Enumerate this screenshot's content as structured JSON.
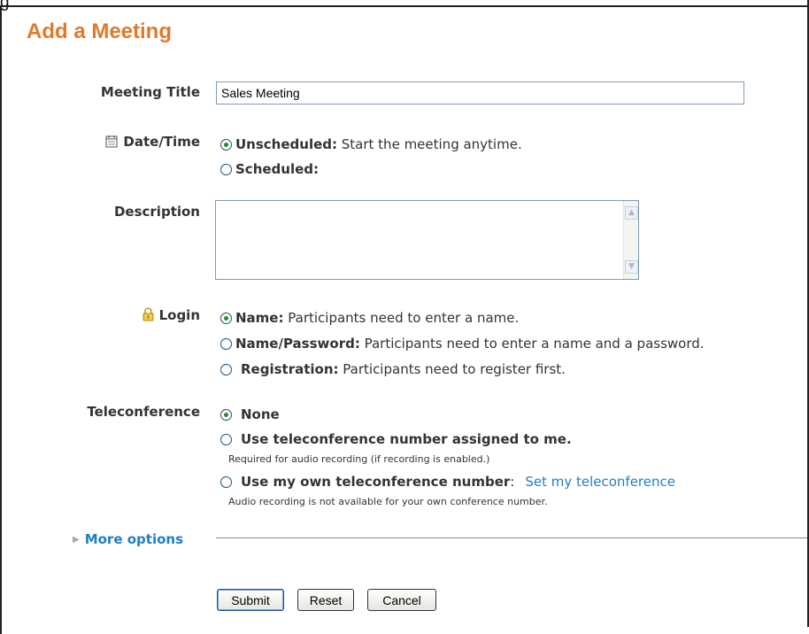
{
  "top_text": "g",
  "title": "Add a Meeting",
  "meeting_title": {
    "label": "Meeting Title",
    "value": "Sales Meeting"
  },
  "datetime": {
    "label": "Date/Time",
    "options": [
      {
        "bold": "Unscheduled:",
        "text": " Start the meeting anytime.",
        "checked": true
      },
      {
        "bold": "Scheduled:",
        "text": "",
        "checked": false
      }
    ]
  },
  "description": {
    "label": "Description",
    "value": ""
  },
  "login": {
    "label": "Login",
    "options": [
      {
        "bold": "Name:",
        "text": " Participants need to enter a name.",
        "checked": true
      },
      {
        "bold": "Name/Password:",
        "text": " Participants need to enter a name and a password.",
        "checked": false
      },
      {
        "bold": "Registration:",
        "text": " Participants need to register first.",
        "checked": false
      }
    ]
  },
  "teleconference": {
    "label": "Teleconference",
    "options": [
      {
        "bold": "None",
        "checked": true
      },
      {
        "bold": "Use teleconference number assigned to me.",
        "note": "Required for audio recording (if recording is enabled.)",
        "checked": false
      },
      {
        "bold": "Use my own teleconference number",
        "suffix": ":",
        "link": "Set my teleconference",
        "note": "Audio recording is not available for your own conference number.",
        "checked": false
      }
    ]
  },
  "more_options": "More options",
  "buttons": {
    "submit": "Submit",
    "reset": "Reset",
    "cancel": "Cancel"
  },
  "icons": {
    "datetime": "calendar-icon",
    "login": "lock-icon",
    "more": "triangle-right-icon"
  },
  "colors": {
    "title": "#e07a2a",
    "link": "#1f7fc4",
    "radio_checked": "#2a8a2a"
  }
}
